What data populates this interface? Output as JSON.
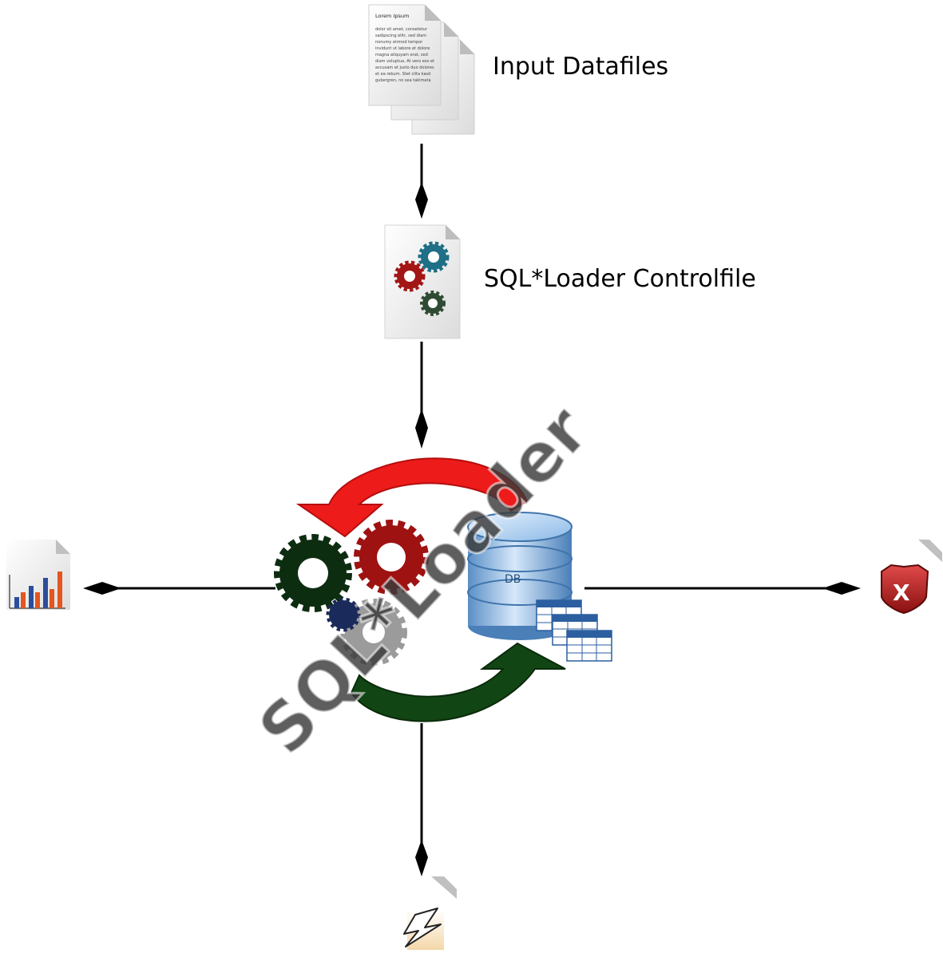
{
  "labels": {
    "input_datafiles": "Input Datafiles",
    "controlfile": "SQL*Loader Controlfile",
    "logo_text": "SQL*Loader",
    "db_label": "DB"
  },
  "document_text": {
    "title": "Lorem Ipsum",
    "lines": [
      "dolor sit amet, consetetur",
      "sadipscing elitr, sed diam",
      "nonumy eirmod tempor",
      "invidunt ut labore et dolore",
      "magna aliquyam erat, sed",
      "diam voluptua. At vero eos et",
      "accusam et justo duo dolores",
      "et ea rebum. Stet clita kasd",
      "gubergren, no sea takimata"
    ]
  },
  "icons": {
    "datafiles": "stacked-document-icon",
    "controlfile": "gears-document-icon",
    "log": "bar-chart-document-icon",
    "bad": "error-shield-icon",
    "discard": "lightning-document-icon",
    "core": "sql-loader-logo-icon"
  },
  "colors": {
    "gear_red": "#a31616",
    "gear_teal": "#1f6f86",
    "gear_green": "#2e4b33",
    "arrow_red": "#ee1b1b",
    "arrow_green": "#124514",
    "db_blue": "#6fa4d8",
    "shield_red": "#b22222",
    "chart_orange": "#e2561f",
    "chart_blue": "#2c4e9a"
  }
}
